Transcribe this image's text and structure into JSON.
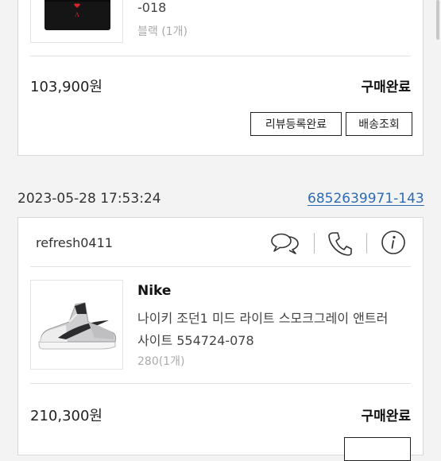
{
  "order1": {
    "code_tail": "-018",
    "option": "블랙 (1개)",
    "price": "103,900원",
    "status": "구매완료",
    "review_button": "리뷰등록완료",
    "tracking_button": "배송조회"
  },
  "order2": {
    "date": "2023-05-28 17:53:24",
    "order_number": "6852639971-143",
    "seller": "refresh0411",
    "brand": "Nike",
    "product_line1": "나이키 조던1 미드 라이트 스모크그레이 앤트러",
    "product_line2": "사이트 554724-078",
    "option": "280(1개)",
    "price": "210,300원",
    "status": "구매완료"
  },
  "icons": [
    "chat-icon",
    "phone-icon",
    "info-icon"
  ],
  "colors": {
    "link": "#2d6bb7",
    "background": "#f3f3f3",
    "border": "#d7d7d7",
    "heart": "#d8232a"
  }
}
